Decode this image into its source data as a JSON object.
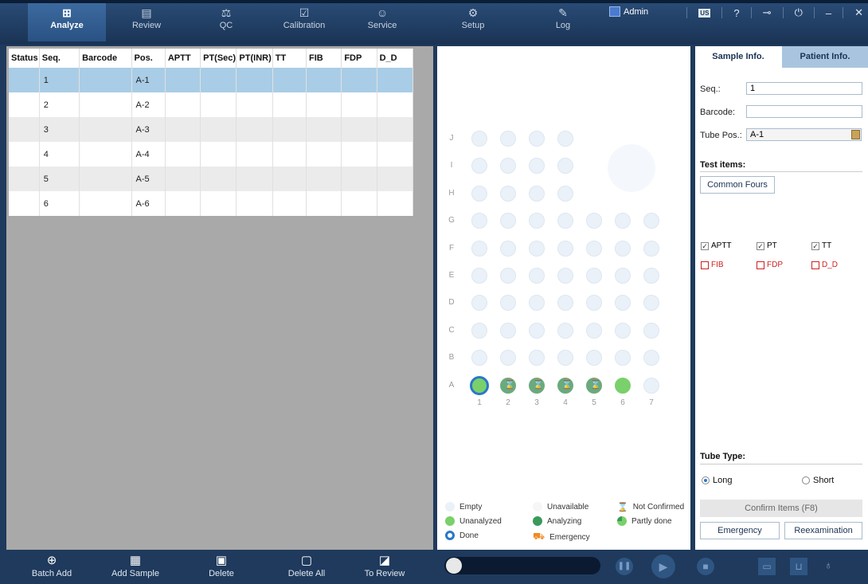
{
  "nav": {
    "tabs": [
      {
        "label": "Analyze",
        "icon": "analyze-icon"
      },
      {
        "label": "Review",
        "icon": "review-icon"
      },
      {
        "label": "QC",
        "icon": "qc-icon"
      },
      {
        "label": "Calibration",
        "icon": "calibration-icon"
      },
      {
        "label": "Service",
        "icon": "service-icon"
      },
      {
        "label": "Setup",
        "icon": "setup-icon"
      },
      {
        "label": "Log",
        "icon": "log-icon"
      }
    ],
    "active_tab": "Analyze",
    "user": "Admin",
    "language": "US"
  },
  "samples": {
    "columns": [
      "Status",
      "Seq.",
      "Barcode",
      "Pos.",
      "APTT",
      "PT(Sec)",
      "PT(INR)",
      "TT",
      "FIB",
      "FDP",
      "D_D"
    ],
    "rows": [
      {
        "status": "",
        "seq": "1",
        "barcode": "",
        "pos": "A-1"
      },
      {
        "status": "",
        "seq": "2",
        "barcode": "",
        "pos": "A-2"
      },
      {
        "status": "",
        "seq": "3",
        "barcode": "",
        "pos": "A-3"
      },
      {
        "status": "",
        "seq": "4",
        "barcode": "",
        "pos": "A-4"
      },
      {
        "status": "",
        "seq": "5",
        "barcode": "",
        "pos": "A-5"
      },
      {
        "status": "",
        "seq": "6",
        "barcode": "",
        "pos": "A-6"
      }
    ],
    "selected_row": 0
  },
  "plate": {
    "rows": [
      "J",
      "I",
      "H",
      "G",
      "F",
      "E",
      "D",
      "C",
      "B",
      "A"
    ],
    "columns": [
      "1",
      "2",
      "3",
      "4",
      "5",
      "6",
      "7"
    ],
    "row_A_states": [
      "selected-unanalyzed",
      "not-confirmed",
      "not-confirmed",
      "not-confirmed",
      "not-confirmed",
      "unanalyzed",
      "empty"
    ],
    "legend": {
      "empty": "Empty",
      "unavailable": "Unavailable",
      "not_confirmed": "Not Confirmed",
      "unanalyzed": "Unanalyzed",
      "analyzing": "Analyzing",
      "partly_done": "Partly done",
      "done": "Done",
      "emergency": "Emergency"
    }
  },
  "info": {
    "tabs": [
      "Sample Info.",
      "Patient Info."
    ],
    "seq_label": "Seq.:",
    "seq_value": "1",
    "barcode_label": "Barcode:",
    "barcode_value": "",
    "tube_pos_label": "Tube Pos.:",
    "tube_pos_value": "A-1",
    "test_items_label": "Test items:",
    "common_fours": "Common Fours",
    "items": [
      {
        "label": "APTT",
        "checked": true,
        "highlight": false
      },
      {
        "label": "PT",
        "checked": true,
        "highlight": false
      },
      {
        "label": "TT",
        "checked": true,
        "highlight": false
      },
      {
        "label": "FIB",
        "checked": false,
        "highlight": true
      },
      {
        "label": "FDP",
        "checked": false,
        "highlight": true
      },
      {
        "label": "D_D",
        "checked": false,
        "highlight": true
      }
    ],
    "tube_type_label": "Tube Type:",
    "tube_long": "Long",
    "tube_short": "Short",
    "tube_selected": "Long",
    "confirm_items": "Confirm Items (F8)",
    "emergency": "Emergency",
    "reexamination": "Reexamination"
  },
  "toolbar": {
    "batch_add": "Batch Add",
    "add_sample": "Add Sample",
    "delete": "Delete",
    "delete_all": "Delete All",
    "to_review": "To Review"
  },
  "colors": {
    "nav_bg": "#1f3a5c",
    "selected_row": "#a9cde6",
    "unanalyzed": "#7ad06a",
    "not_confirmed": "#6aaa7d",
    "done_ring": "#2a78c8",
    "highlight_red": "#d02020"
  }
}
